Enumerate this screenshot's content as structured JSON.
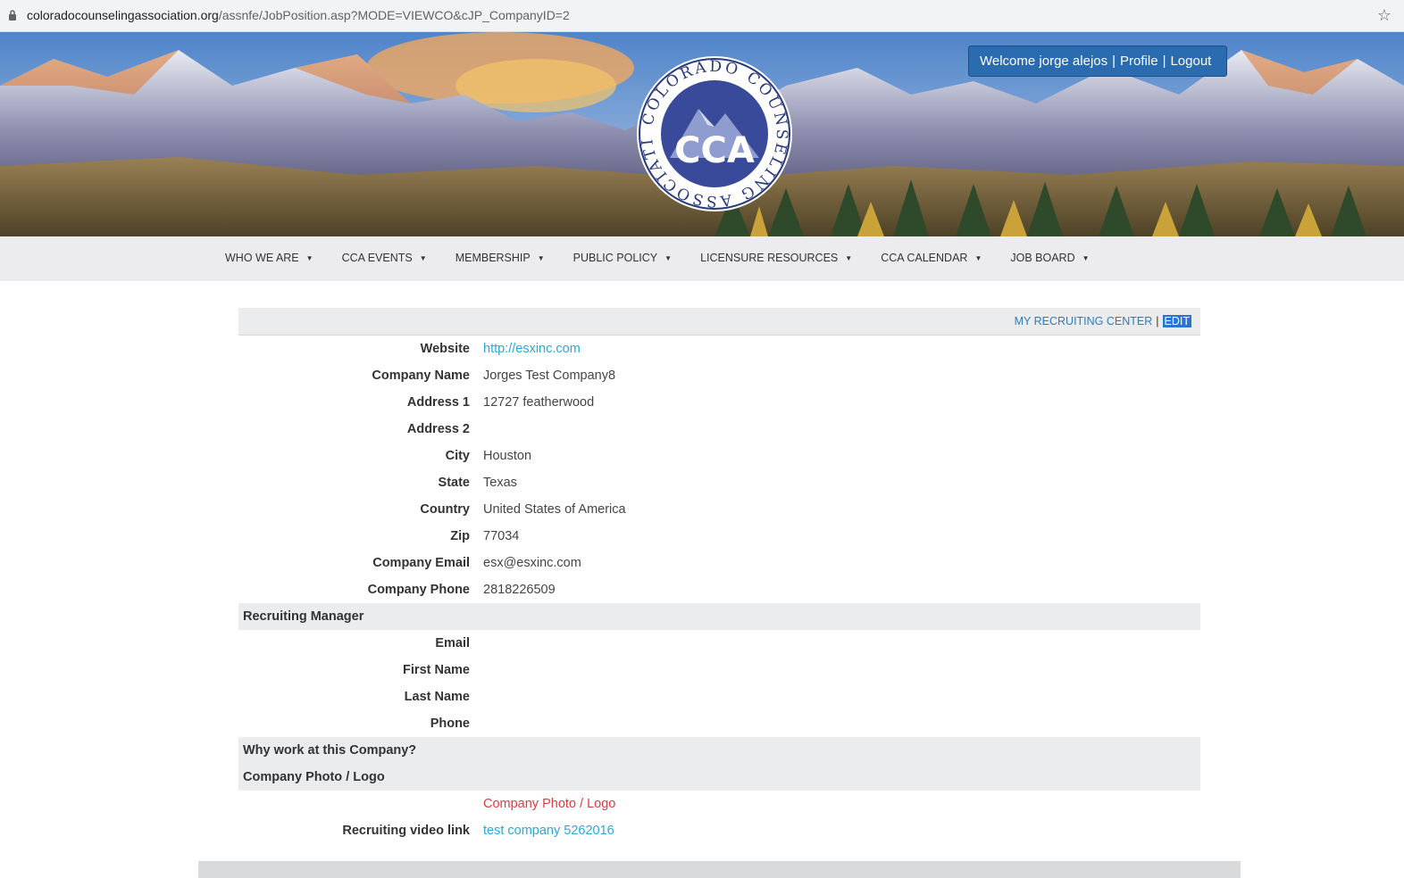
{
  "browser": {
    "url_host": "coloradocounselingassociation.org",
    "url_path": "/assnfe/JobPosition.asp?MODE=VIEWCO&cJP_CompanyID=2"
  },
  "header": {
    "welcome": "Welcome jorge alejos",
    "profile": "Profile",
    "logout": "Logout",
    "logo_text": "CCA",
    "logo_ring_text": "COLORADO COUNSELING ASSOCIATION"
  },
  "nav": {
    "items": [
      {
        "label": "WHO WE ARE"
      },
      {
        "label": "CCA EVENTS"
      },
      {
        "label": "MEMBERSHIP"
      },
      {
        "label": "PUBLIC POLICY"
      },
      {
        "label": "LICENSURE RESOURCES"
      },
      {
        "label": "CCA CALENDAR"
      },
      {
        "label": "JOB BOARD"
      }
    ]
  },
  "toolbar": {
    "recruiting_center": "MY RECRUITING CENTER",
    "separator": "|",
    "edit": "EDIT"
  },
  "company": {
    "website_label": "Website",
    "website": "http://esxinc.com",
    "name_label": "Company Name",
    "name": "Jorges Test Company8",
    "address1_label": "Address 1",
    "address1": "12727 featherwood",
    "address2_label": "Address 2",
    "address2": "",
    "city_label": "City",
    "city": "Houston",
    "state_label": "State",
    "state": "Texas",
    "country_label": "Country",
    "country": "United States of America",
    "zip_label": "Zip",
    "zip": "77034",
    "email_label": "Company Email",
    "email": "esx@esxinc.com",
    "phone_label": "Company Phone",
    "phone": "2818226509"
  },
  "recruiting_manager": {
    "title": "Recruiting Manager",
    "email_label": "Email",
    "email": "",
    "first_name_label": "First Name",
    "first_name": "",
    "last_name_label": "Last Name",
    "last_name": "",
    "phone_label": "Phone",
    "phone": ""
  },
  "why_work": {
    "title": "Why work at this Company?"
  },
  "photo": {
    "title": "Company Photo / Logo",
    "placeholder": "Company Photo / Logo"
  },
  "video": {
    "label": "Recruiting video link",
    "link": "test company 5262016"
  },
  "colors": {
    "brand_blue": "#2b6bb0",
    "link_cyan": "#2aa8d9",
    "link_blue": "#2f7bbf",
    "error_red": "#e03b3b",
    "section_gray": "#ebecee"
  }
}
